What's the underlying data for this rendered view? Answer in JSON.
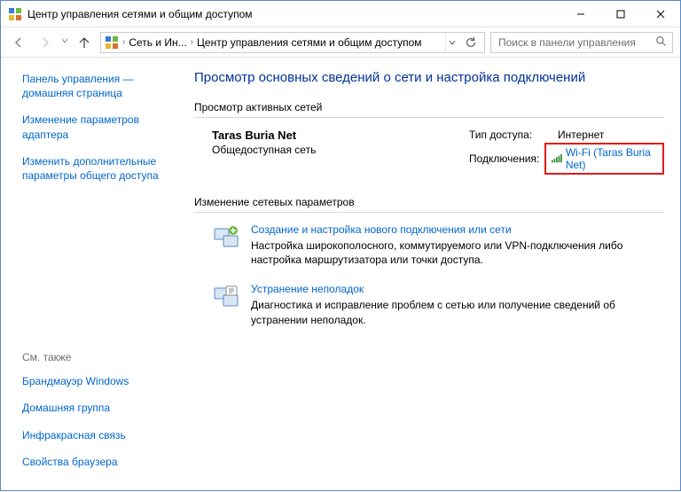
{
  "window": {
    "title": "Центр управления сетями и общим доступом"
  },
  "breadcrumb": {
    "part1": "Сеть и Ин...",
    "part2": "Центр управления сетями и общим доступом"
  },
  "search": {
    "placeholder": "Поиск в панели управления"
  },
  "sidebar": {
    "links": {
      "home": "Панель управления — домашняя страница",
      "adapter": "Изменение параметров адаптера",
      "sharing": "Изменить дополнительные параметры общего доступа"
    },
    "seealso_title": "См. также",
    "seealso": {
      "firewall": "Брандмауэр Windows",
      "homegroup": "Домашняя группа",
      "infrared": "Инфракрасная связь",
      "browser": "Свойства браузера"
    }
  },
  "main": {
    "heading": "Просмотр основных сведений о сети и настройка подключений",
    "active_networks_title": "Просмотр активных сетей",
    "network": {
      "name": "Taras Buria Net",
      "profile": "Общедоступная сеть",
      "access_label": "Тип доступа:",
      "access_value": "Интернет",
      "conn_label": "Подключения:",
      "conn_value": "Wi-Fi (Taras Buria Net)"
    },
    "netparams_title": "Изменение сетевых параметров",
    "setup": {
      "link": "Создание и настройка нового подключения или сети",
      "desc": "Настройка широкополосного, коммутируемого или VPN-подключения либо настройка маршрутизатора или точки доступа."
    },
    "troubleshoot": {
      "link": "Устранение неполадок",
      "desc": "Диагностика и исправление проблем с сетью или получение сведений об устранении неполадок."
    }
  }
}
